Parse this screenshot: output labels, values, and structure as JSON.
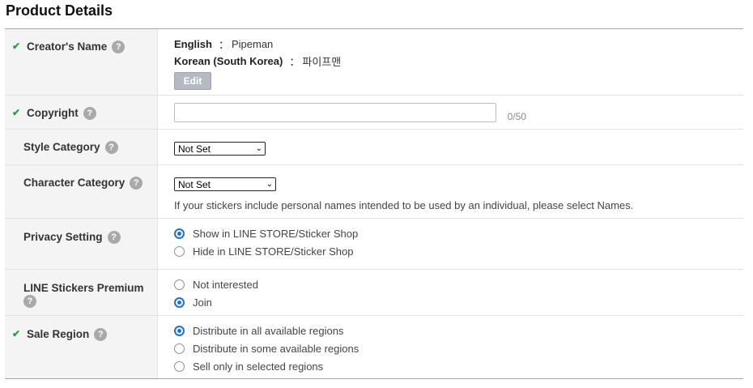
{
  "page": {
    "title": "Product Details"
  },
  "help_glyph": "?",
  "check_glyph": "✔",
  "rows": {
    "creator_name": {
      "label": "Creator's Name",
      "english_key": "English",
      "english_value": "Pipeman",
      "korean_key": "Korean (South Korea)",
      "korean_value": "파이프맨",
      "separator": "：",
      "edit_label": "Edit"
    },
    "copyright": {
      "label": "Copyright",
      "value": "",
      "counter": "0/50"
    },
    "style_category": {
      "label": "Style Category",
      "selected": "Not Set"
    },
    "character_category": {
      "label": "Character Category",
      "selected": "Not Set",
      "note": "If your stickers include personal names intended to be used by an individual, please select Names."
    },
    "privacy_setting": {
      "label": "Privacy Setting",
      "options": [
        "Show in LINE STORE/Sticker Shop",
        "Hide in LINE STORE/Sticker Shop"
      ],
      "selected_index": 0
    },
    "premium": {
      "label": "LINE Stickers Premium",
      "options": [
        "Not interested",
        "Join"
      ],
      "selected_index": 1
    },
    "sale_region": {
      "label": "Sale Region",
      "options": [
        "Distribute in all available regions",
        "Distribute in some available regions",
        "Sell only in selected regions"
      ],
      "selected_index": 0
    }
  },
  "colors": {
    "check": "#22a23b",
    "radio_selected": "#1d6fe0",
    "label_bg": "#f4f4f4",
    "edit_button": "#b4b9c2"
  }
}
